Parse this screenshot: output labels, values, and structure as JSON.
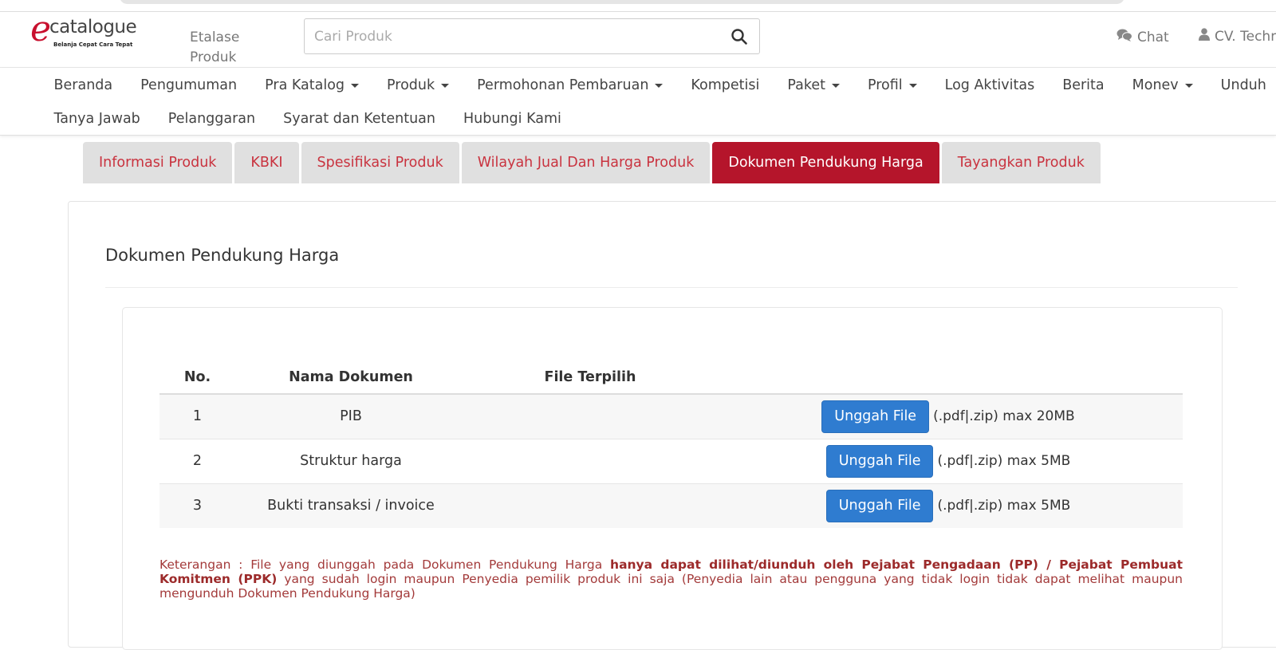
{
  "header": {
    "logo_text": "catalogue",
    "logo_letter": "e",
    "logo_tagline": "Belanja Cepat Cara Tepat",
    "etalase_line1": "Etalase",
    "etalase_line2": "Produk",
    "search_placeholder": "Cari Produk",
    "chat_label": "Chat",
    "user_label": "CV. Techn"
  },
  "nav": {
    "row1": [
      {
        "label": "Beranda",
        "dropdown": false
      },
      {
        "label": "Pengumuman",
        "dropdown": false
      },
      {
        "label": "Pra Katalog",
        "dropdown": true
      },
      {
        "label": "Produk",
        "dropdown": true
      },
      {
        "label": "Permohonan Pembaruan",
        "dropdown": true
      },
      {
        "label": "Kompetisi",
        "dropdown": false
      },
      {
        "label": "Paket",
        "dropdown": true
      },
      {
        "label": "Profil",
        "dropdown": true
      },
      {
        "label": "Log Aktivitas",
        "dropdown": false
      },
      {
        "label": "Berita",
        "dropdown": false
      },
      {
        "label": "Monev",
        "dropdown": true
      },
      {
        "label": "Unduh",
        "dropdown": false
      }
    ],
    "row2": [
      {
        "label": "Tanya Jawab",
        "dropdown": false
      },
      {
        "label": "Pelanggaran",
        "dropdown": false
      },
      {
        "label": "Syarat dan Ketentuan",
        "dropdown": false
      },
      {
        "label": "Hubungi Kami",
        "dropdown": false
      }
    ]
  },
  "tabs": [
    {
      "label": "Informasi Produk",
      "active": false
    },
    {
      "label": "KBKI",
      "active": false
    },
    {
      "label": "Spesifikasi Produk",
      "active": false
    },
    {
      "label": "Wilayah Jual Dan Harga Produk",
      "active": false
    },
    {
      "label": "Dokumen Pendukung Harga",
      "active": true
    },
    {
      "label": "Tayangkan Produk",
      "active": false
    }
  ],
  "panel": {
    "title": "Dokumen Pendukung Harga"
  },
  "table": {
    "headers": {
      "no": "No.",
      "name": "Nama Dokumen",
      "file": "File Terpilih"
    },
    "rows": [
      {
        "no": "1",
        "name": "PIB",
        "file": "",
        "button": "Unggah File",
        "ext": "(.pdf|.zip) max 20MB"
      },
      {
        "no": "2",
        "name": "Struktur harga",
        "file": "",
        "button": "Unggah File",
        "ext": "(.pdf|.zip) max 5MB"
      },
      {
        "no": "3",
        "name": "Bukti transaksi / invoice",
        "file": "",
        "button": "Unggah File",
        "ext": "(.pdf|.zip) max 5MB"
      }
    ]
  },
  "note": {
    "prefix": "Keterangan : File yang diunggah pada Dokumen Pendukung Harga ",
    "bold": "hanya dapat dilihat/diunduh oleh Pejabat Pengadaan (PP) / Pejabat Pembuat Komitmen (PPK)",
    "suffix": " yang sudah login maupun Penyedia pemilik produk ini saja (Penyedia lain atau pengguna yang tidak login tidak dapat melihat maupun mengunduh Dokumen Pendukung Harga)"
  },
  "colors": {
    "brand": "#c8102e",
    "active_tab": "#b5152b",
    "button": "#2f7cd0",
    "note": "#a33a3a"
  }
}
